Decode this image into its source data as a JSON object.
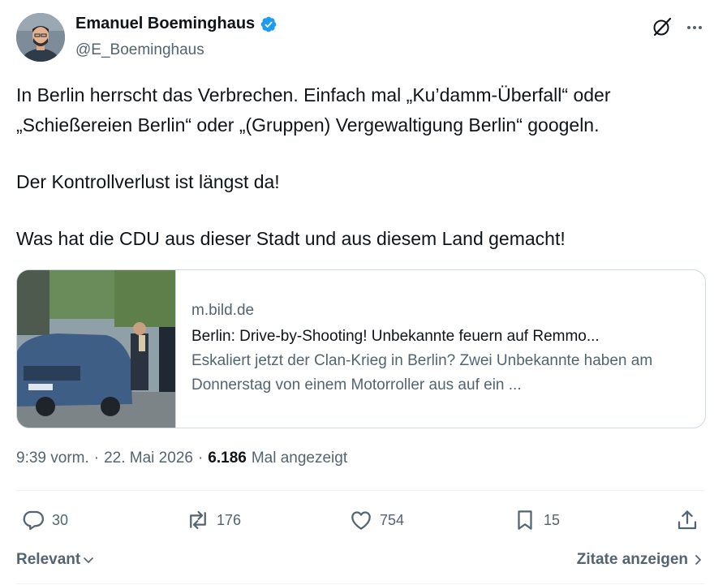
{
  "author": {
    "display_name": "Emanuel Boeminghaus",
    "handle": "@E_Boeminghaus",
    "verified": true
  },
  "tweet": {
    "paragraphs": [
      "In Berlin herrscht das Verbrechen. Einfach mal „Ku’damm-Überfall“ oder „Schießereien Berlin“ oder „(Gruppen) Vergewaltigung Berlin“ googeln.",
      "Der Kontrollverlust ist längst da!",
      "Was hat die CDU aus dieser Stadt und aus diesem Land gemacht!"
    ]
  },
  "link_card": {
    "domain": "m.bild.de",
    "title": "Berlin: Drive-by-Shooting! Unbekannte feuern auf Remmo...",
    "description": "Eskaliert jetzt der Clan-Krieg in Berlin? Zwei Unbekannte haben am Donnerstag von einem Motorroller aus auf ein ..."
  },
  "meta": {
    "time": "9:39 vorm.",
    "separator": "·",
    "date": "22. Mai 2026",
    "views_count": "6.186",
    "views_label": "Mal angezeigt"
  },
  "actions": {
    "replies": "30",
    "reposts": "176",
    "likes": "754",
    "bookmarks": "15"
  },
  "footer": {
    "sort_label": "Relevant",
    "quotes_label": "Zitate anzeigen"
  },
  "colors": {
    "text_primary": "#0f1419",
    "text_secondary": "#536471",
    "verified_blue": "#1d9bf0",
    "border": "#cfd9de"
  },
  "icons": [
    "grok-icon",
    "more-icon",
    "verified-icon",
    "reply-icon",
    "repost-icon",
    "like-icon",
    "bookmark-icon",
    "share-icon",
    "chevron-down-icon",
    "chevron-right-icon"
  ]
}
